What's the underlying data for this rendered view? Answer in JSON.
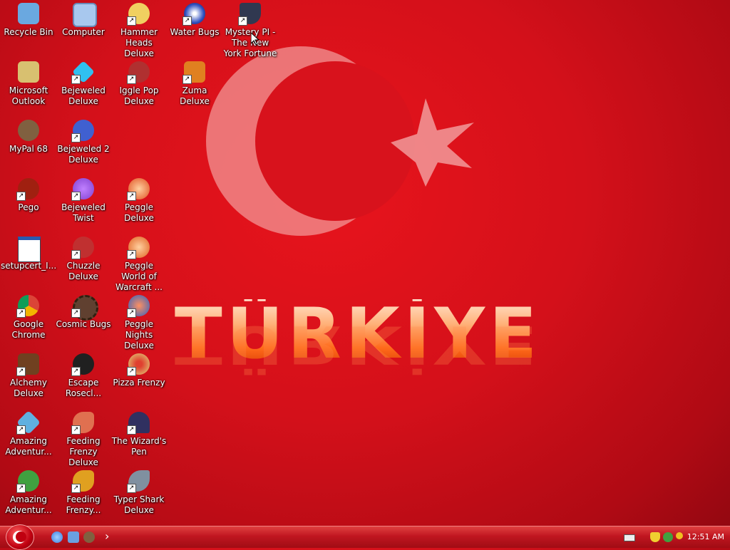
{
  "wallpaper": {
    "word": "TÜRKİYE"
  },
  "desktop": {
    "icons": [
      {
        "label": "Recycle Bin",
        "icon": "recycle-bin-icon",
        "shortcut": false,
        "color": "#6aa8e0"
      },
      {
        "label": "Computer",
        "icon": "computer-icon",
        "shortcut": false,
        "color": "#a8c8ee"
      },
      {
        "label": "Hammer Heads Deluxe",
        "icon": "hammer-heads-icon",
        "shortcut": true,
        "color": "#f0d060"
      },
      {
        "label": "Water Bugs",
        "icon": "water-bugs-icon",
        "shortcut": true,
        "color": "#3050c0"
      },
      {
        "label": "Mystery PI - The New York Fortune",
        "icon": "mystery-pi-icon",
        "shortcut": true,
        "color": "#303850"
      },
      {
        "label": "Microsoft Outlook",
        "icon": "outlook-icon",
        "shortcut": false,
        "color": "#d8c070"
      },
      {
        "label": "Bejeweled Deluxe",
        "icon": "bejeweled-icon",
        "shortcut": true,
        "color": "#30c0f0"
      },
      {
        "label": "Iggle Pop Deluxe",
        "icon": "iggle-pop-icon",
        "shortcut": true,
        "color": "#b03030"
      },
      {
        "label": "Zuma Deluxe",
        "icon": "zuma-icon",
        "shortcut": true,
        "color": "#e08020"
      },
      {
        "label": "MyPal 68",
        "icon": "mypal-icon",
        "shortcut": false,
        "color": "#806040"
      },
      {
        "label": "Bejeweled 2 Deluxe",
        "icon": "bejeweled-2-icon",
        "shortcut": true,
        "color": "#4060d0"
      },
      {
        "label": "Pego",
        "icon": "pego-icon",
        "shortcut": true,
        "color": "#a02010"
      },
      {
        "label": "Bejeweled Twist",
        "icon": "bejeweled-twist-icon",
        "shortcut": true,
        "color": "#8040d0"
      },
      {
        "label": "Peggle Deluxe",
        "icon": "peggle-icon",
        "shortcut": true,
        "color": "#e05020"
      },
      {
        "label": "setupcert_I...",
        "icon": "setup-window-icon",
        "shortcut": false,
        "color": "#ffffff"
      },
      {
        "label": "Chuzzle Deluxe",
        "icon": "chuzzle-icon",
        "shortcut": true,
        "color": "#c03030"
      },
      {
        "label": "Peggle World of Warcraft ...",
        "icon": "peggle-wow-icon",
        "shortcut": true,
        "color": "#e06020"
      },
      {
        "label": "Google Chrome",
        "icon": "chrome-icon",
        "shortcut": true,
        "color": "#4080e0"
      },
      {
        "label": "Cosmic Bugs",
        "icon": "cosmic-bugs-icon",
        "shortcut": true,
        "color": "#604030"
      },
      {
        "label": "Peggle Nights Deluxe",
        "icon": "peggle-nights-icon",
        "shortcut": true,
        "color": "#3060c0"
      },
      {
        "label": "Alchemy Deluxe",
        "icon": "alchemy-icon",
        "shortcut": true,
        "color": "#704020"
      },
      {
        "label": "Escape Rosecl...",
        "icon": "escape-rosecliff-icon",
        "shortcut": true,
        "color": "#202020"
      },
      {
        "label": "Pizza Frenzy",
        "icon": "pizza-frenzy-icon",
        "shortcut": true,
        "color": "#e0a060"
      },
      {
        "label": "Amazing Adventur...",
        "icon": "amazing-adventures-icon",
        "shortcut": true,
        "color": "#60b0e0"
      },
      {
        "label": "Feeding Frenzy Deluxe",
        "icon": "feeding-frenzy-icon",
        "shortcut": true,
        "color": "#e07050"
      },
      {
        "label": "The Wizard's Pen",
        "icon": "wizards-pen-icon",
        "shortcut": true,
        "color": "#303060"
      },
      {
        "label": "Amazing Adventur...",
        "icon": "amazing-adventures-2-icon",
        "shortcut": true,
        "color": "#40a040"
      },
      {
        "label": "Feeding Frenzy...",
        "icon": "feeding-frenzy-2-icon",
        "shortcut": true,
        "color": "#e0a020"
      },
      {
        "label": "Typer Shark Deluxe",
        "icon": "typer-shark-icon",
        "shortcut": true,
        "color": "#8090a0"
      }
    ]
  },
  "taskbar": {
    "start_icon": "start-button-icon",
    "quick_launch": [
      {
        "icon": "internet-explorer-icon",
        "color": "#3a7be0"
      },
      {
        "icon": "show-desktop-icon",
        "color": "#6aa0e0"
      },
      {
        "icon": "mypal-quicklaunch-icon",
        "color": "#806040"
      }
    ],
    "expand_glyph": "›",
    "tray": {
      "clock": "12:51 AM"
    }
  }
}
